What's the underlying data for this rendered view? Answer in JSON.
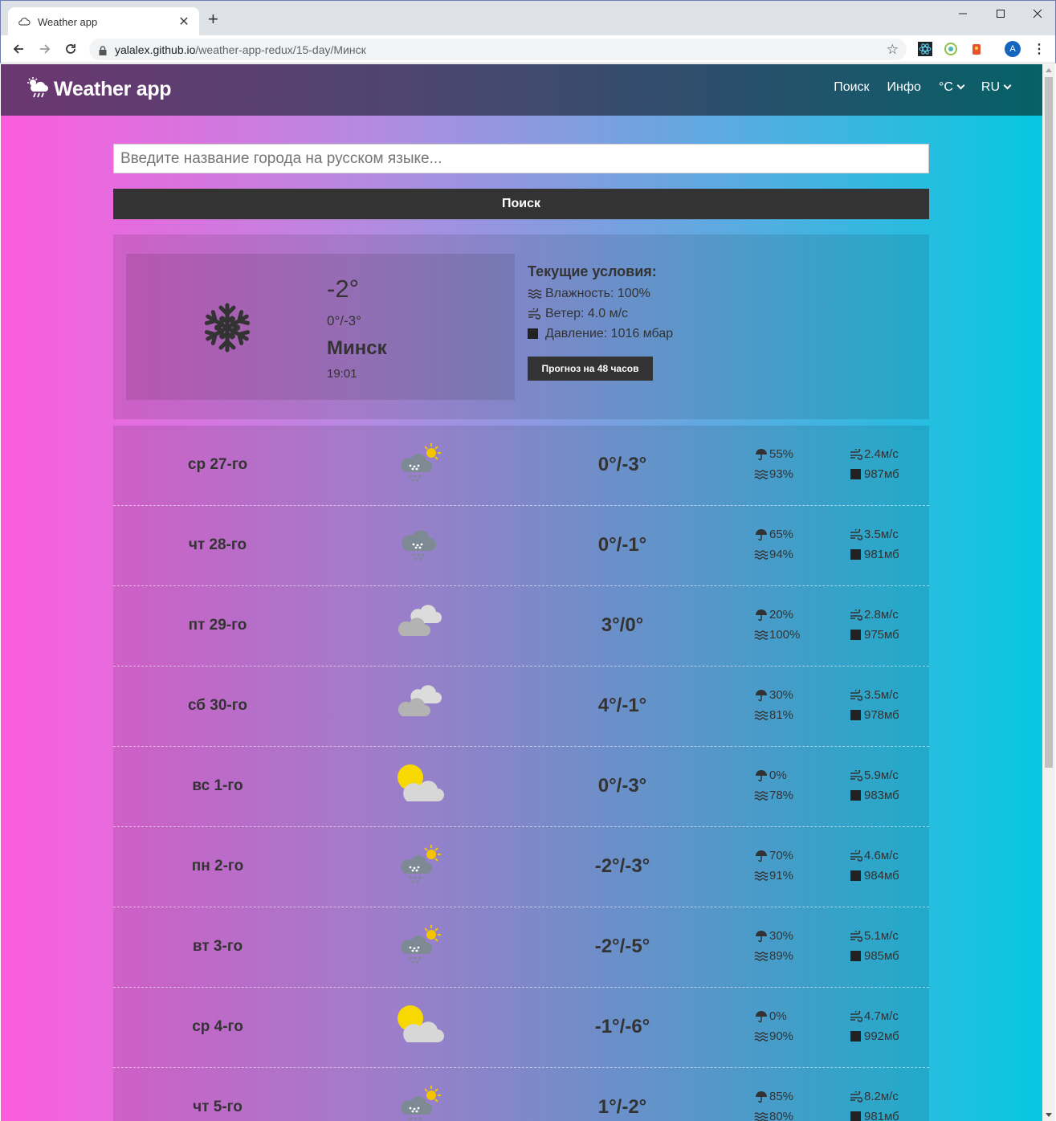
{
  "browser": {
    "tab_title": "Weather app",
    "url_host": "yalalex.github.io",
    "url_path": "/weather-app-redux/15-day/Минск",
    "profile_initial": "A"
  },
  "header": {
    "brand": "Weather app",
    "nav": {
      "search": "Поиск",
      "info": "Инфо",
      "units": "°C",
      "lang": "RU"
    }
  },
  "search": {
    "placeholder": "Введите название города на русском языке...",
    "button": "Поиск"
  },
  "current": {
    "icon": "snowflake-icon",
    "temp": "-2°",
    "range": "0°/-3°",
    "city": "Минск",
    "time": "19:01",
    "conditions_title": "Текущие условия:",
    "humidity": "Влажность: 100%",
    "wind": "Ветер: 4.0 м/с",
    "pressure": "Давление: 1016 мбар",
    "forecast48_button": "Прогноз на 48 часов"
  },
  "days": [
    {
      "name": "ср 27-го",
      "icon": "snow-sun-cloud-icon",
      "temp": "0°/-3°",
      "precip": "55%",
      "humidity": "93%",
      "wind": "2.4м/с",
      "pressure": "987мб"
    },
    {
      "name": "чт 28-го",
      "icon": "snow-cloud-icon",
      "temp": "0°/-1°",
      "precip": "65%",
      "humidity": "94%",
      "wind": "3.5м/с",
      "pressure": "981мб"
    },
    {
      "name": "пт 29-го",
      "icon": "overcast-icon",
      "temp": "3°/0°",
      "precip": "20%",
      "humidity": "100%",
      "wind": "2.8м/с",
      "pressure": "975мб"
    },
    {
      "name": "сб 30-го",
      "icon": "overcast-icon",
      "temp": "4°/-1°",
      "precip": "30%",
      "humidity": "81%",
      "wind": "3.5м/с",
      "pressure": "978мб"
    },
    {
      "name": "вс 1-го",
      "icon": "partly-cloudy-icon",
      "temp": "0°/-3°",
      "precip": "0%",
      "humidity": "78%",
      "wind": "5.9м/с",
      "pressure": "983мб"
    },
    {
      "name": "пн 2-го",
      "icon": "snow-sun-cloud-icon",
      "temp": "-2°/-3°",
      "precip": "70%",
      "humidity": "91%",
      "wind": "4.6м/с",
      "pressure": "984мб"
    },
    {
      "name": "вт 3-го",
      "icon": "snow-sun-cloud-icon",
      "temp": "-2°/-5°",
      "precip": "30%",
      "humidity": "89%",
      "wind": "5.1м/с",
      "pressure": "985мб"
    },
    {
      "name": "ср 4-го",
      "icon": "partly-cloudy-icon",
      "temp": "-1°/-6°",
      "precip": "0%",
      "humidity": "90%",
      "wind": "4.7м/с",
      "pressure": "992мб"
    },
    {
      "name": "чт 5-го",
      "icon": "snow-sun-cloud-icon",
      "temp": "1°/-2°",
      "precip": "85%",
      "humidity": "80%",
      "wind": "8.2м/с",
      "pressure": "981мб"
    }
  ],
  "colors": {
    "gradient_left": "#fd5cdd",
    "gradient_right": "#06c8e0",
    "header_left": "#6b3770",
    "header_right": "#066167",
    "button_bg": "#333333",
    "text": "#333333"
  }
}
